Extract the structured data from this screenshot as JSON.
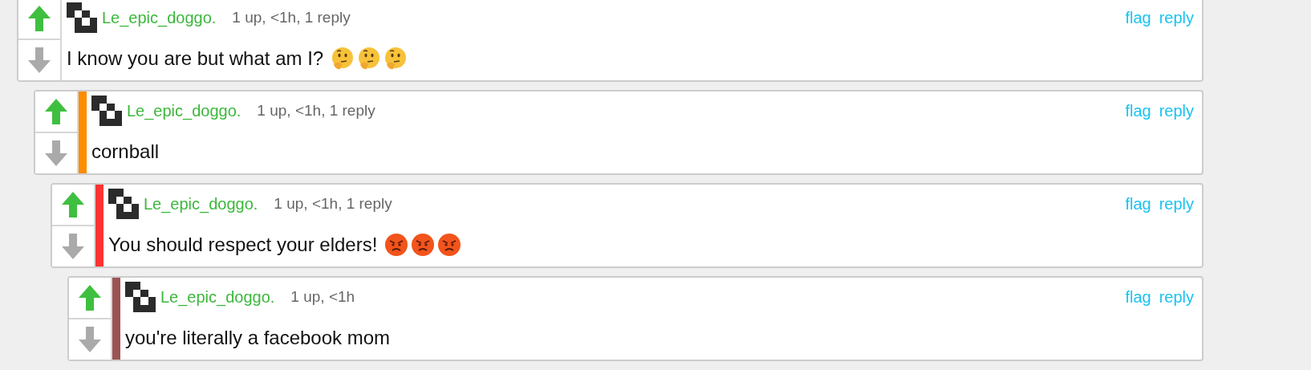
{
  "comments": [
    {
      "author": "Le_epic_doggo.",
      "meta": "1 up, <1h, 1 reply",
      "actions": [
        "flag",
        "reply"
      ],
      "text": "I know you are but what am I?",
      "emoji": [
        {
          "kind": "thinking"
        },
        {
          "kind": "thinking"
        },
        {
          "kind": "thinking"
        }
      ],
      "children": [
        {
          "author": "Le_epic_doggo.",
          "meta": "1 up, <1h, 1 reply",
          "actions": [
            "flag",
            "reply"
          ],
          "text": "cornball",
          "color": "#ff8c00",
          "children": [
            {
              "author": "Le_epic_doggo.",
              "meta": "1 up, <1h, 1 reply",
              "actions": [
                "flag",
                "reply"
              ],
              "text": "You should respect your elders!",
              "color": "#ff3333",
              "emoji": [
                {
                  "kind": "angry"
                },
                {
                  "kind": "angry"
                },
                {
                  "kind": "angry"
                }
              ],
              "children": [
                {
                  "author": "Le_epic_doggo.",
                  "meta": "1 up, <1h",
                  "actions": [
                    "flag",
                    "reply"
                  ],
                  "text": "you're literally a facebook mom",
                  "color": "#9b5454"
                }
              ]
            }
          ]
        }
      ]
    }
  ]
}
